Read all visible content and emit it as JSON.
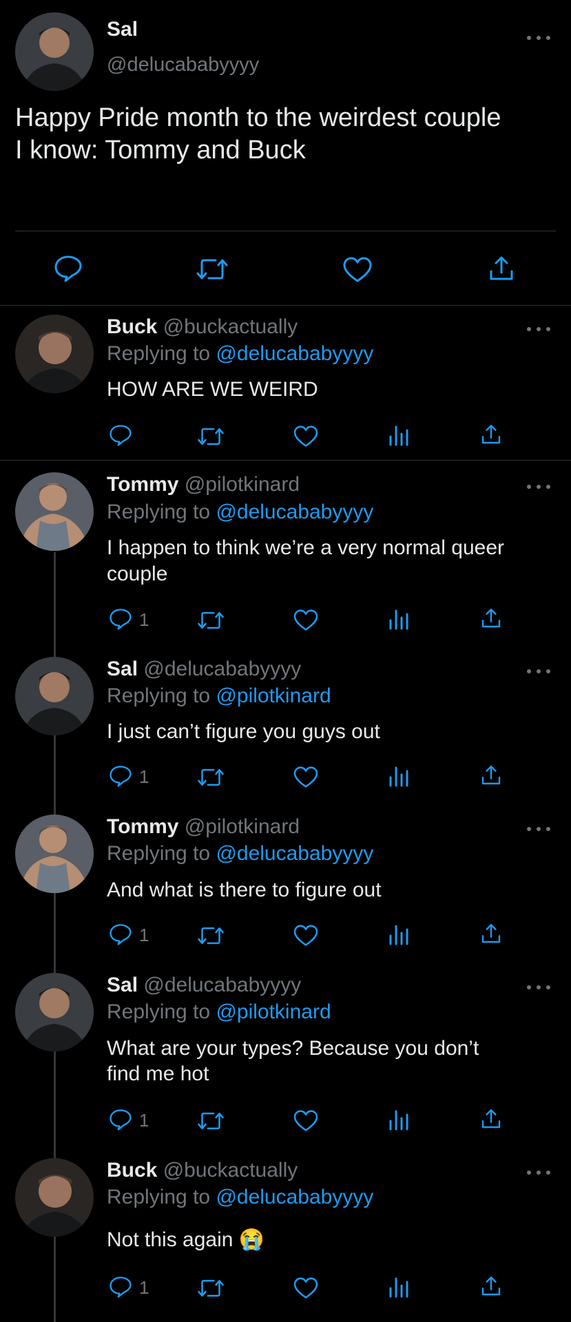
{
  "main_tweet": {
    "name": "Sal",
    "handle": "@delucababyyyy",
    "text_line1": "Happy Pride month to the weirdest couple",
    "text_line2": "I know: Tommy and Buck"
  },
  "replies": [
    {
      "name": "Buck",
      "handle": "@buckactually",
      "replying_prefix": "Replying to",
      "replying_to": "@delucababyyyy",
      "text_line1": "HOW ARE WE WEIRD",
      "text_line2": "",
      "reply_count": ""
    },
    {
      "name": "Tommy",
      "handle": "@pilotkinard",
      "replying_prefix": "Replying to",
      "replying_to": "@delucababyyyy",
      "text_line1": "I happen to think we’re a very normal queer",
      "text_line2": "couple",
      "reply_count": "1"
    },
    {
      "name": "Sal",
      "handle": "@delucababyyyy",
      "replying_prefix": "Replying to",
      "replying_to": "@pilotkinard",
      "text_line1": "I just can’t figure you guys out",
      "text_line2": "",
      "reply_count": "1"
    },
    {
      "name": "Tommy",
      "handle": "@pilotkinard",
      "replying_prefix": "Replying to",
      "replying_to": "@delucababyyyy",
      "text_line1": "And what is there to figure out",
      "text_line2": "",
      "reply_count": "1"
    },
    {
      "name": "Sal",
      "handle": "@delucababyyyy",
      "replying_prefix": "Replying to",
      "replying_to": "@pilotkinard",
      "text_line1": "What are your types? Because you don’t",
      "text_line2": "find me hot",
      "reply_count": "1"
    },
    {
      "name": "Buck",
      "handle": "@buckactually",
      "replying_prefix": "Replying to",
      "replying_to": "@delucababyyyy",
      "text_line1": "Not this again",
      "text_line2": "",
      "emoji": "😭",
      "reply_count": "1"
    }
  ],
  "icons": {
    "reply": "reply-icon",
    "retweet": "retweet-icon",
    "like": "heart-icon",
    "views": "views-icon",
    "share": "share-icon",
    "more": "more-icon"
  },
  "colors": {
    "background": "#000000",
    "text": "#e7e9ea",
    "muted": "#71767b",
    "link": "#1d9bf0",
    "divider": "#2f3336"
  }
}
